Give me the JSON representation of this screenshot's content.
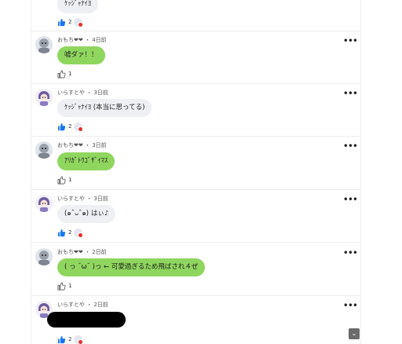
{
  "comments": [
    {
      "id": "c0",
      "bubble": "ｹｯｼﾞｬﾅｲﾖ",
      "likes": "2",
      "thumb": "blue",
      "reaction": true
    },
    {
      "id": "c1",
      "author": "おもち❤❤",
      "sep": "・",
      "time": "4日前",
      "bubble": "嘘ダァ！！",
      "bubble_color": "green",
      "likes": "1",
      "thumb": "outline",
      "reaction": false
    },
    {
      "id": "c2",
      "author": "いらすとや",
      "sep": "・",
      "time": "3日前",
      "bubble": "ｹｯｼﾞｬﾅｲﾖ (本当に思ってる)",
      "bubble_color": "gray",
      "likes": "2",
      "thumb": "blue",
      "reaction": true
    },
    {
      "id": "c3",
      "author": "おもち❤❤",
      "sep": "・",
      "time": "3日前",
      "bubble": "ｱﾘｶﾞﾄｳｺﾞｻﾞｲﾏｽ",
      "bubble_color": "green",
      "likes": "1",
      "thumb": "outline",
      "reaction": false
    },
    {
      "id": "c4",
      "author": "いらすとや",
      "sep": "・",
      "time": "3日前",
      "bubble": "(๑ˆᴗˆ๑) はぃ♪",
      "bubble_color": "gray",
      "likes": "2",
      "thumb": "blue",
      "reaction": true
    },
    {
      "id": "c5",
      "author": "おもち❤❤",
      "sep": "・",
      "time": "2日前",
      "bubble": "( っ ˘ω˘ )っ ← 可愛過ぎるため飛ばされ４ぜ",
      "bubble_color": "green",
      "likes": "1",
      "thumb": "outline",
      "reaction": false
    },
    {
      "id": "c6",
      "author": "いらすとや",
      "sep": "・",
      "time": "2日前",
      "likes": "2",
      "thumb": "blue",
      "reaction": true
    }
  ],
  "more_label": "•••",
  "scroll_label": "⌄",
  "icons": {
    "like": "thumbs-up-icon",
    "more": "more-options-icon",
    "avatar_omochi": "gray-character-avatar",
    "avatar_irasutoya": "purple-character-avatar"
  },
  "colors": {
    "green_bubble": "#8fd65e",
    "gray_bubble": "#eef0f3",
    "like_blue": "#1877f2"
  }
}
